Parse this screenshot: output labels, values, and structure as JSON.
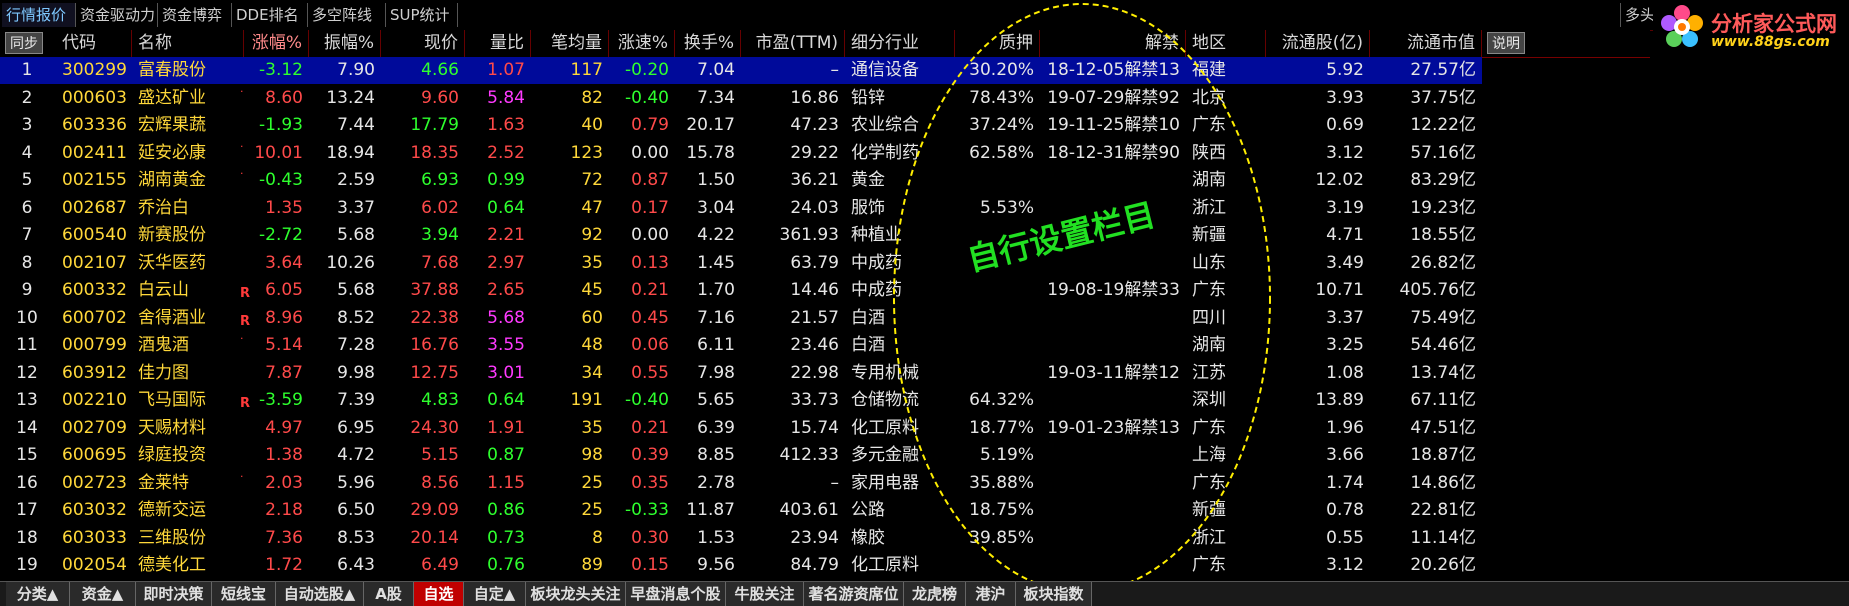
{
  "top_tabs": [
    "行情报价",
    "资金驱动力",
    "资金博弈",
    "DDE排名",
    "多空阵线",
    "SUP统计"
  ],
  "top_right_tab": "多头",
  "logo": {
    "brand": "分析家公式网",
    "url": "www.88gs.com"
  },
  "header": {
    "step_button": "同步",
    "explain_button": "说明",
    "columns": [
      "代码",
      "名称",
      "涨幅%",
      "振幅%",
      "现价",
      "量比",
      "笔均量",
      "涨速%",
      "换手%",
      "市盈(TTM)",
      "细分行业",
      "质押",
      "解禁",
      "地区",
      "流通股(亿)",
      "流通市值"
    ]
  },
  "overlay_label": "自行设置栏目",
  "rows": [
    {
      "idx": "1",
      "code": "300299",
      "name": "富春股份",
      "mark": "",
      "chg": "-3.12",
      "amp": "7.90",
      "price": "4.66",
      "vr": "1.07",
      "avg": "117",
      "spd": "-0.20",
      "turn": "7.04",
      "pe": "–",
      "ind": "通信设备",
      "pledge": "30.20%",
      "unlock": "18-12-05解禁13",
      "region": "福建",
      "float": "5.92",
      "mcap": "27.57亿"
    },
    {
      "idx": "2",
      "code": "000603",
      "name": "盛达矿业",
      "mark": "·",
      "chg": "8.60",
      "amp": "13.24",
      "price": "9.60",
      "vr": "5.84",
      "avg": "82",
      "spd": "-0.40",
      "turn": "7.34",
      "pe": "16.86",
      "ind": "铅锌",
      "pledge": "78.43%",
      "unlock": "19-07-29解禁92",
      "region": "北京",
      "float": "3.93",
      "mcap": "37.75亿"
    },
    {
      "idx": "3",
      "code": "603336",
      "name": "宏辉果蔬",
      "mark": "",
      "chg": "-1.93",
      "amp": "7.44",
      "price": "17.79",
      "vr": "1.63",
      "avg": "40",
      "spd": "0.79",
      "turn": "20.17",
      "pe": "47.23",
      "ind": "农业综合",
      "pledge": "37.24%",
      "unlock": "19-11-25解禁10",
      "region": "广东",
      "float": "0.69",
      "mcap": "12.22亿"
    },
    {
      "idx": "4",
      "code": "002411",
      "name": "延安必康",
      "mark": "·",
      "chg": "10.01",
      "amp": "18.94",
      "price": "18.35",
      "vr": "2.52",
      "avg": "123",
      "spd": "0.00",
      "turn": "15.78",
      "pe": "29.22",
      "ind": "化学制药",
      "pledge": "62.58%",
      "unlock": "18-12-31解禁90",
      "region": "陕西",
      "float": "3.12",
      "mcap": "57.16亿"
    },
    {
      "idx": "5",
      "code": "002155",
      "name": "湖南黄金",
      "mark": "·",
      "chg": "-0.43",
      "amp": "2.59",
      "price": "6.93",
      "vr": "0.99",
      "avg": "72",
      "spd": "0.87",
      "turn": "1.50",
      "pe": "36.21",
      "ind": "黄金",
      "pledge": "",
      "unlock": "",
      "region": "湖南",
      "float": "12.02",
      "mcap": "83.29亿"
    },
    {
      "idx": "6",
      "code": "002687",
      "name": "乔治白",
      "mark": "",
      "chg": "1.35",
      "amp": "3.37",
      "price": "6.02",
      "vr": "0.64",
      "avg": "47",
      "spd": "0.17",
      "turn": "3.04",
      "pe": "24.03",
      "ind": "服饰",
      "pledge": "5.53%",
      "unlock": "",
      "region": "浙江",
      "float": "3.19",
      "mcap": "19.23亿"
    },
    {
      "idx": "7",
      "code": "600540",
      "name": "新赛股份",
      "mark": "",
      "chg": "-2.72",
      "amp": "5.68",
      "price": "3.94",
      "vr": "2.21",
      "avg": "92",
      "spd": "0.00",
      "turn": "4.22",
      "pe": "361.93",
      "ind": "种植业",
      "pledge": "",
      "unlock": "",
      "region": "新疆",
      "float": "4.71",
      "mcap": "18.55亿"
    },
    {
      "idx": "8",
      "code": "002107",
      "name": "沃华医药",
      "mark": "",
      "chg": "3.64",
      "amp": "10.26",
      "price": "7.68",
      "vr": "2.97",
      "avg": "35",
      "spd": "0.13",
      "turn": "1.45",
      "pe": "63.79",
      "ind": "中成药",
      "pledge": "",
      "unlock": "",
      "region": "山东",
      "float": "3.49",
      "mcap": "26.82亿"
    },
    {
      "idx": "9",
      "code": "600332",
      "name": "白云山",
      "mark": "R",
      "chg": "6.05",
      "amp": "5.68",
      "price": "37.88",
      "vr": "2.65",
      "avg": "45",
      "spd": "0.21",
      "turn": "1.70",
      "pe": "14.46",
      "ind": "中成药",
      "pledge": "",
      "unlock": "19-08-19解禁33",
      "region": "广东",
      "float": "10.71",
      "mcap": "405.76亿"
    },
    {
      "idx": "10",
      "code": "600702",
      "name": "舍得酒业",
      "mark": "R",
      "chg": "8.96",
      "amp": "8.52",
      "price": "22.38",
      "vr": "5.68",
      "avg": "60",
      "spd": "0.45",
      "turn": "7.16",
      "pe": "21.57",
      "ind": "白酒",
      "pledge": "",
      "unlock": "",
      "region": "四川",
      "float": "3.37",
      "mcap": "75.49亿"
    },
    {
      "idx": "11",
      "code": "000799",
      "name": "酒鬼酒",
      "mark": "·",
      "chg": "5.14",
      "amp": "7.28",
      "price": "16.76",
      "vr": "3.55",
      "avg": "48",
      "spd": "0.06",
      "turn": "6.11",
      "pe": "23.46",
      "ind": "白酒",
      "pledge": "",
      "unlock": "",
      "region": "湖南",
      "float": "3.25",
      "mcap": "54.46亿"
    },
    {
      "idx": "12",
      "code": "603912",
      "name": "佳力图",
      "mark": "",
      "chg": "7.87",
      "amp": "9.98",
      "price": "12.75",
      "vr": "3.01",
      "avg": "34",
      "spd": "0.55",
      "turn": "7.98",
      "pe": "22.98",
      "ind": "专用机械",
      "pledge": "",
      "unlock": "19-03-11解禁12",
      "region": "江苏",
      "float": "1.08",
      "mcap": "13.74亿"
    },
    {
      "idx": "13",
      "code": "002210",
      "name": "飞马国际",
      "mark": "R",
      "chg": "-3.59",
      "amp": "7.39",
      "price": "4.83",
      "vr": "0.64",
      "avg": "191",
      "spd": "-0.40",
      "turn": "5.65",
      "pe": "33.73",
      "ind": "仓储物流",
      "pledge": "64.32%",
      "unlock": "",
      "region": "深圳",
      "float": "13.89",
      "mcap": "67.11亿"
    },
    {
      "idx": "14",
      "code": "002709",
      "name": "天赐材料",
      "mark": "",
      "chg": "4.97",
      "amp": "6.95",
      "price": "24.30",
      "vr": "1.91",
      "avg": "35",
      "spd": "0.21",
      "turn": "6.39",
      "pe": "15.74",
      "ind": "化工原料",
      "pledge": "18.77%",
      "unlock": "19-01-23解禁13",
      "region": "广东",
      "float": "1.96",
      "mcap": "47.51亿"
    },
    {
      "idx": "15",
      "code": "600695",
      "name": "绿庭投资",
      "mark": "",
      "chg": "1.38",
      "amp": "4.72",
      "price": "5.15",
      "vr": "0.87",
      "avg": "98",
      "spd": "0.39",
      "turn": "8.85",
      "pe": "412.33",
      "ind": "多元金融",
      "pledge": "5.19%",
      "unlock": "",
      "region": "上海",
      "float": "3.66",
      "mcap": "18.87亿"
    },
    {
      "idx": "16",
      "code": "002723",
      "name": "金莱特",
      "mark": "·",
      "chg": "2.03",
      "amp": "5.96",
      "price": "8.56",
      "vr": "1.15",
      "avg": "25",
      "spd": "0.35",
      "turn": "2.78",
      "pe": "–",
      "ind": "家用电器",
      "pledge": "35.88%",
      "unlock": "",
      "region": "广东",
      "float": "1.74",
      "mcap": "14.86亿"
    },
    {
      "idx": "17",
      "code": "603032",
      "name": "德新交运",
      "mark": "",
      "chg": "2.18",
      "amp": "6.50",
      "price": "29.09",
      "vr": "0.86",
      "avg": "25",
      "spd": "-0.33",
      "turn": "11.87",
      "pe": "403.61",
      "ind": "公路",
      "pledge": "18.75%",
      "unlock": "",
      "region": "新疆",
      "float": "0.78",
      "mcap": "22.81亿"
    },
    {
      "idx": "18",
      "code": "603033",
      "name": "三维股份",
      "mark": "",
      "chg": "7.36",
      "amp": "8.53",
      "price": "20.14",
      "vr": "0.73",
      "avg": "8",
      "spd": "0.30",
      "turn": "1.53",
      "pe": "23.94",
      "ind": "橡胶",
      "pledge": "39.85%",
      "unlock": "",
      "region": "浙江",
      "float": "0.55",
      "mcap": "11.14亿"
    },
    {
      "idx": "19",
      "code": "002054",
      "name": "德美化工",
      "mark": "",
      "chg": "1.72",
      "amp": "6.43",
      "price": "6.49",
      "vr": "0.76",
      "avg": "89",
      "spd": "0.15",
      "turn": "9.56",
      "pe": "84.79",
      "ind": "化工原料",
      "pledge": "",
      "unlock": "",
      "region": "广东",
      "float": "3.12",
      "mcap": "20.26亿"
    }
  ],
  "bottom_tabs": [
    "分类▲",
    "资金▲",
    "即时决策",
    "短线宝",
    "自动选股▲",
    "A股",
    "自选",
    "自定▲",
    "板块龙头关注",
    "早盘消息个股",
    "牛股关注",
    "著名游资席位",
    "龙虎榜",
    "港沪",
    "板块指数"
  ],
  "active_bottom_tab": "自选",
  "colors": {
    "up": "#ff4a4a",
    "down": "#2eff2e",
    "selected_row": "#000a9a",
    "code": "#ffd83a",
    "ellipse": "#ffee00"
  }
}
